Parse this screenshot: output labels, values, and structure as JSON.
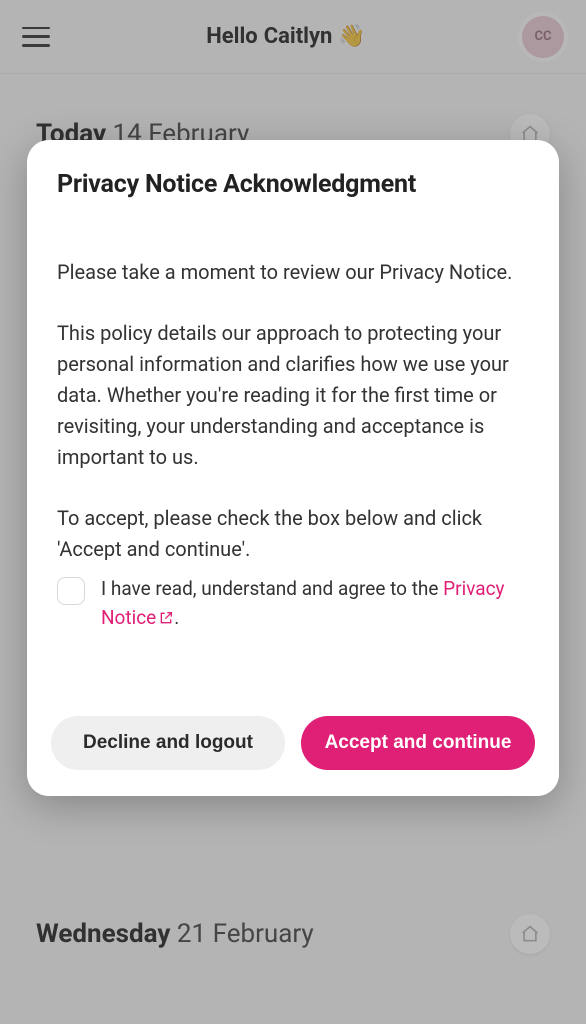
{
  "header": {
    "greeting_prefix": "Hello",
    "user_name": "Caitlyn",
    "avatar_initials": "CC"
  },
  "days": {
    "today": {
      "label_strong": "Today",
      "label_rest": "14 February"
    },
    "next": {
      "label_strong": "Wednesday",
      "label_rest": "21 February"
    }
  },
  "modal": {
    "title": "Privacy Notice Acknowledgment",
    "para1": "Please take a moment to review our Privacy Notice.",
    "para2": "This policy details our approach to protecting your personal information and clarifies how we use your data. Whether you're reading it for the first time or revisiting, your understanding and acceptance is important to us.",
    "para3": "To accept, please check the box below and click 'Accept and continue'.",
    "checkbox_label_pre": "I have read, understand and agree to the ",
    "checkbox_link_text": "Privacy Notice",
    "checkbox_label_post": ".",
    "decline_label": "Decline and logout",
    "accept_label": "Accept and continue"
  },
  "colors": {
    "accent": "#e01f76"
  }
}
